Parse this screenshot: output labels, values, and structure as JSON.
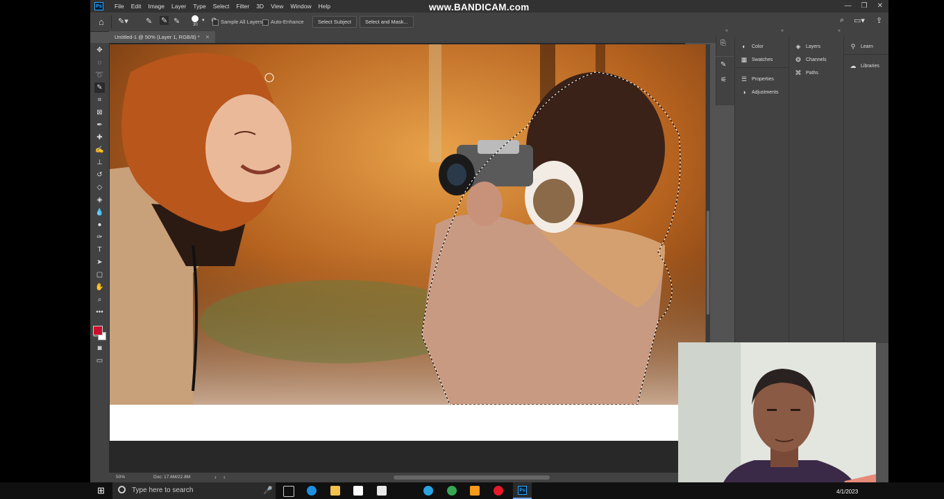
{
  "menubar": {
    "app_logo": "Ps",
    "menus": [
      "File",
      "Edit",
      "Image",
      "Layer",
      "Type",
      "Select",
      "Filter",
      "3D",
      "View",
      "Window",
      "Help"
    ],
    "watermark": "www.BANDICAM.com"
  },
  "options_bar": {
    "brush_size": "30",
    "sample_all_layers": "Sample All Layers",
    "auto_enhance": "Auto-Enhance",
    "select_subject": "Select Subject",
    "select_and_mask": "Select and Mask..."
  },
  "document": {
    "tab_title": "Untitled-1 @ 50% (Layer 1, RGB/8) *"
  },
  "status_bar": {
    "zoom": "50%",
    "doc_size": "Doc: 17.6M/22.8M"
  },
  "panels": {
    "col1": [
      "Color",
      "Swatches",
      "Properties",
      "Adjustments"
    ],
    "col2": [
      "Layers",
      "Channels",
      "Paths"
    ],
    "col3": [
      "Learn",
      "Libraries"
    ]
  },
  "colors": {
    "foreground": "#c8102e",
    "background": "#ffffff",
    "ui_dark": "#323232",
    "ui_panel": "#424242",
    "ui_bg": "#535353"
  },
  "taskbar": {
    "search_placeholder": "Type here to search",
    "date": "4/1/2023"
  }
}
